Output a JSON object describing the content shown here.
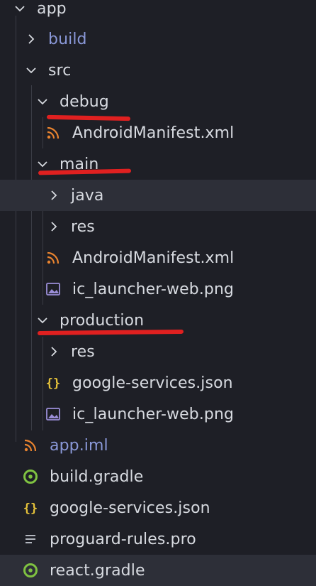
{
  "tree": {
    "items": [
      {
        "label": "app",
        "kind": "folder-open"
      },
      {
        "label": "build",
        "kind": "folder-closed"
      },
      {
        "label": "src",
        "kind": "folder-open"
      },
      {
        "label": "debug",
        "kind": "folder-open"
      },
      {
        "label": "AndroidManifest.xml",
        "kind": "xml-file"
      },
      {
        "label": "main",
        "kind": "folder-open"
      },
      {
        "label": "java",
        "kind": "folder-closed"
      },
      {
        "label": "res",
        "kind": "folder-closed"
      },
      {
        "label": "AndroidManifest.xml",
        "kind": "xml-file"
      },
      {
        "label": "ic_launcher-web.png",
        "kind": "image-file"
      },
      {
        "label": "production",
        "kind": "folder-open"
      },
      {
        "label": "res",
        "kind": "folder-closed"
      },
      {
        "label": "google-services.json",
        "kind": "json-file"
      },
      {
        "label": "ic_launcher-web.png",
        "kind": "image-file"
      },
      {
        "label": "app.iml",
        "kind": "iml-file"
      },
      {
        "label": "build.gradle",
        "kind": "gradle-file"
      },
      {
        "label": "google-services.json",
        "kind": "json-file"
      },
      {
        "label": "proguard-rules.pro",
        "kind": "text-file"
      },
      {
        "label": "react.gradle",
        "kind": "gradle-file"
      }
    ]
  },
  "colors": {
    "background": "#1e1f26",
    "selection": "#2d2f38",
    "text": "#d7dae0",
    "dim_text": "#8a98d8",
    "annotation_red": "#e02020",
    "rss_orange": "#e8832f",
    "json_yellow": "#e5c23a",
    "gradle_green": "#7fc241",
    "image_purple": "#9b8ed8"
  }
}
